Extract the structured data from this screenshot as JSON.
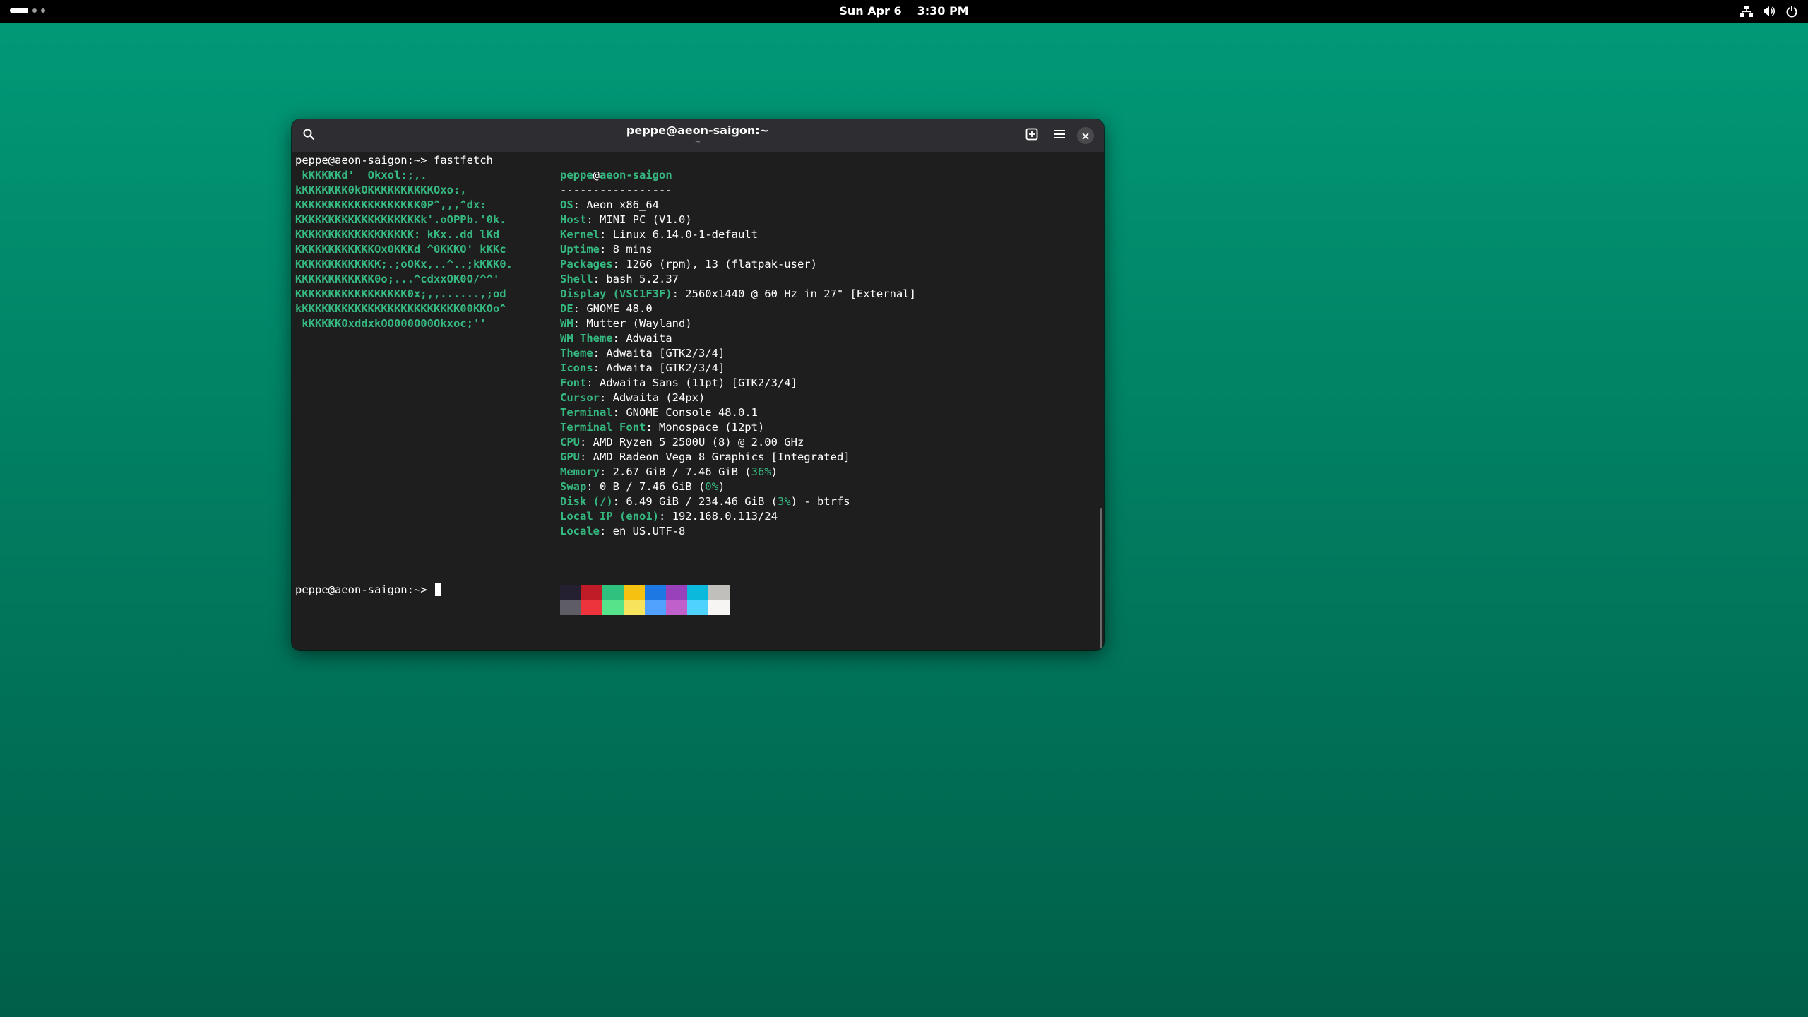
{
  "topbar": {
    "date": "Sun Apr 6",
    "time": "3:30 PM",
    "icons": [
      "network-icon",
      "volume-icon",
      "power-icon"
    ]
  },
  "window": {
    "title": "peppe@aeon-saigon:~",
    "subtitle": "~",
    "buttons": [
      "search-icon",
      "new-tab-icon",
      "hamburger-menu-icon",
      "close-icon"
    ]
  },
  "terminal": {
    "command_line": {
      "prompt": "peppe@aeon-saigon:~>",
      "command": "fastfetch"
    },
    "logo": [
      " kKKKKKd'  Okxol:;,.",
      "kKKKKKKK0kOKKKKKKKKKKOxo:,",
      "KKKKKKKKKKKKKKKKKKK0P^,,,^dx:",
      "KKKKKKKKKKKKKKKKKKKk'.oOPPb.'0k.",
      "KKKKKKKKKKKKKKKKKK: kKx..dd lKd",
      "KKKKKKKKKKKKOx0KKKd ^0KKKO' kKKc",
      "KKKKKKKKKKKKK;.;oOKx,..^..;kKKK0.",
      "KKKKKKKKKKKK0o;...^cdxxOK0O/^^'",
      "KKKKKKKKKKKKKKKKK0x;,,......,;od",
      "kKKKKKKKKKKKKKKKKKKKKKKKK00KKOo^",
      " kKKKKKOxddxkOO000000Okxoc;''"
    ],
    "header": {
      "user": "peppe",
      "host": "aeon-saigon",
      "separator": "-----------------"
    },
    "info": [
      {
        "key": "OS",
        "value": "Aeon x86_64"
      },
      {
        "key": "Host",
        "value": "MINI PC (V1.0)"
      },
      {
        "key": "Kernel",
        "value": "Linux 6.14.0-1-default"
      },
      {
        "key": "Uptime",
        "value": "8 mins"
      },
      {
        "key": "Packages",
        "value": "1266 (rpm), 13 (flatpak-user)"
      },
      {
        "key": "Shell",
        "value": "bash 5.2.37"
      },
      {
        "key": "Display (VSC1F3F)",
        "value": "2560x1440 @ 60 Hz in 27\" [External]"
      },
      {
        "key": "DE",
        "value": "GNOME 48.0"
      },
      {
        "key": "WM",
        "value": "Mutter (Wayland)"
      },
      {
        "key": "WM Theme",
        "value": "Adwaita"
      },
      {
        "key": "Theme",
        "value": "Adwaita [GTK2/3/4]"
      },
      {
        "key": "Icons",
        "value": "Adwaita [GTK2/3/4]"
      },
      {
        "key": "Font",
        "value": "Adwaita Sans (11pt) [GTK2/3/4]"
      },
      {
        "key": "Cursor",
        "value": "Adwaita (24px)"
      },
      {
        "key": "Terminal",
        "value": "GNOME Console 48.0.1"
      },
      {
        "key": "Terminal Font",
        "value": "Monospace (12pt)"
      },
      {
        "key": "CPU",
        "value": "AMD Ryzen 5 2500U (8) @ 2.00 GHz"
      },
      {
        "key": "GPU",
        "value": "AMD Radeon Vega 8 Graphics [Integrated]"
      },
      {
        "key": "Memory",
        "value": "2.67 GiB / 7.46 GiB (",
        "pct": "36%",
        "tail": ")"
      },
      {
        "key": "Swap",
        "value": "0 B / 7.46 GiB (",
        "pct": "0%",
        "tail": ")"
      },
      {
        "key": "Disk (/)",
        "value": "6.49 GiB / 234.46 GiB (",
        "pct": "3%",
        "tail": ") - btrfs"
      },
      {
        "key": "Local IP (eno1)",
        "value": "192.168.0.113/24"
      },
      {
        "key": "Locale",
        "value": "en_US.UTF-8"
      }
    ],
    "palette_row1": [
      "#241f31",
      "#c01c28",
      "#2ec27e",
      "#f5c211",
      "#1e78e4",
      "#9841bb",
      "#0ab9dc",
      "#c0bfbc"
    ],
    "palette_row2": [
      "#5e5c64",
      "#ed333b",
      "#57e389",
      "#f8e45c",
      "#51a1ff",
      "#c061cb",
      "#4fd2fd",
      "#f6f5f4"
    ],
    "final_prompt": "peppe@aeon-saigon:~>"
  },
  "colors": {
    "accent_green": "#36b980",
    "terminal_bg": "#1e1e1e",
    "titlebar_bg": "#2e2e32",
    "desktop_top": "#019a78",
    "desktop_bottom": "#005f48"
  }
}
